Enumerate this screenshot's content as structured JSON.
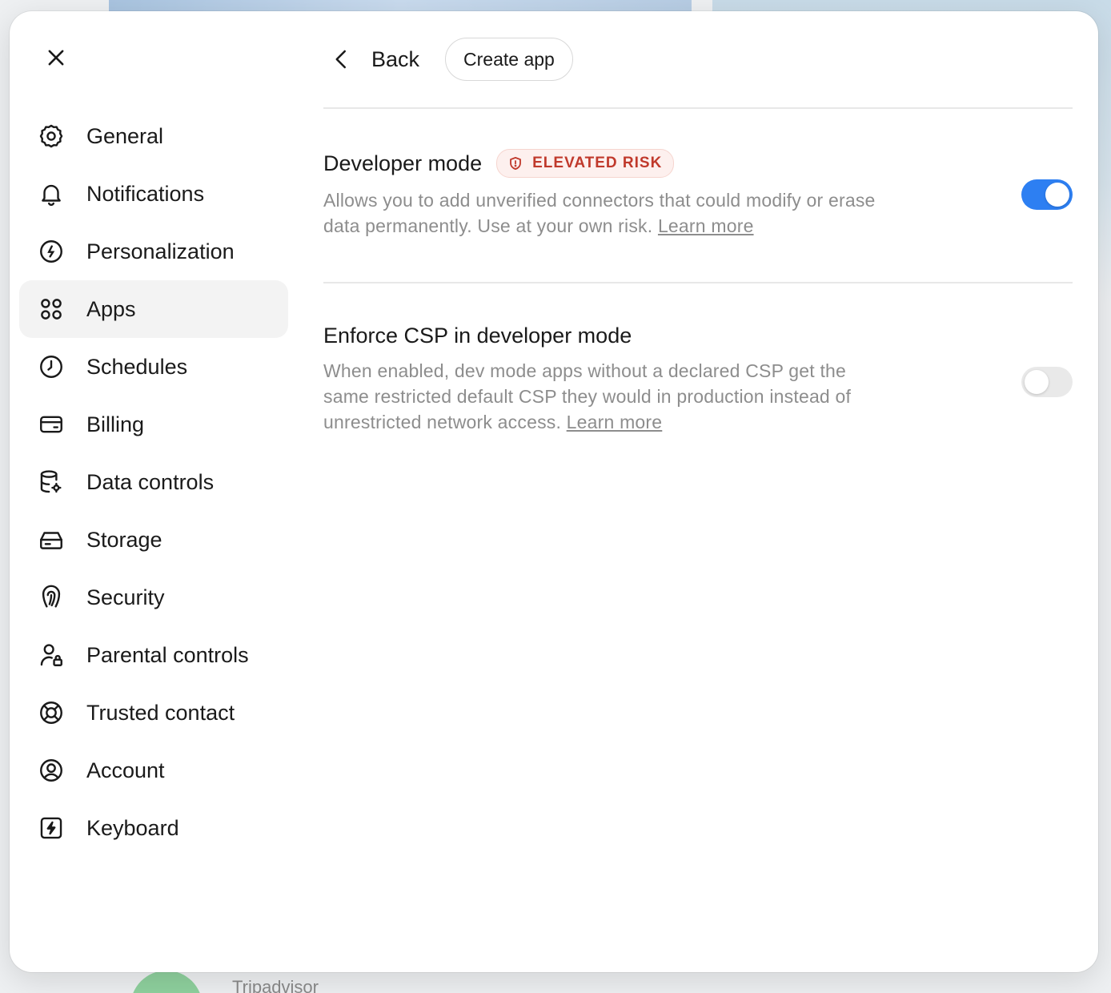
{
  "background": {
    "label": "Tripadvisor"
  },
  "sidebar": {
    "items": [
      {
        "label": "General",
        "icon": "gear-icon",
        "active": false
      },
      {
        "label": "Notifications",
        "icon": "bell-icon",
        "active": false
      },
      {
        "label": "Personalization",
        "icon": "personalization-icon",
        "active": false
      },
      {
        "label": "Apps",
        "icon": "apps-grid-icon",
        "active": true
      },
      {
        "label": "Schedules",
        "icon": "clock-icon",
        "active": false
      },
      {
        "label": "Billing",
        "icon": "credit-card-icon",
        "active": false
      },
      {
        "label": "Data controls",
        "icon": "database-gear-icon",
        "active": false
      },
      {
        "label": "Storage",
        "icon": "hard-drive-icon",
        "active": false
      },
      {
        "label": "Security",
        "icon": "fingerprint-icon",
        "active": false
      },
      {
        "label": "Parental controls",
        "icon": "user-lock-icon",
        "active": false
      },
      {
        "label": "Trusted contact",
        "icon": "lifebuoy-icon",
        "active": false
      },
      {
        "label": "Account",
        "icon": "user-circle-icon",
        "active": false
      },
      {
        "label": "Keyboard",
        "icon": "keyboard-bolt-icon",
        "active": false
      }
    ]
  },
  "header": {
    "back_label": "Back",
    "create_app_label": "Create app"
  },
  "settings": {
    "developer_mode": {
      "title": "Developer mode",
      "badge": "ELEVATED RISK",
      "description": "Allows you to add unverified connectors that could modify or erase data permanently. Use at your own risk.",
      "link": "Learn more",
      "enabled": true
    },
    "enforce_csp": {
      "title": "Enforce CSP in developer mode",
      "description": "When enabled, dev mode apps without a declared CSP get the same restricted default CSP they would in production instead of unrestricted network access.",
      "link": "Learn more",
      "enabled": false
    }
  },
  "colors": {
    "accent": "#2d7ff2",
    "risk": "#c0392b",
    "risk_bg": "#fdf0ee",
    "active_nav_bg": "#f3f3f3"
  }
}
